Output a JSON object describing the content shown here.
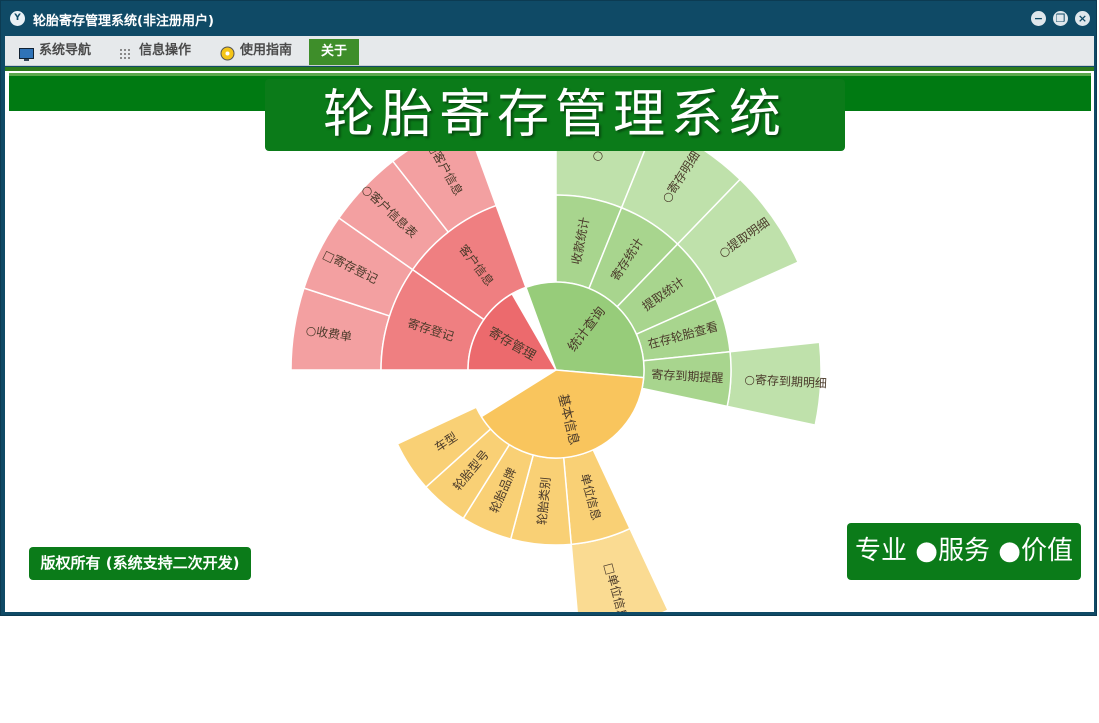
{
  "window": {
    "title": "轮胎寄存管理系统(非注册用户)",
    "app_icon": "Y",
    "buttons": {
      "minimize": "−",
      "restore": "❐",
      "close": "×"
    }
  },
  "menu": {
    "items": [
      {
        "label": "系统导航",
        "icon": "monitor-icon"
      },
      {
        "label": "信息操作",
        "icon": "grid-icon"
      },
      {
        "label": "使用指南",
        "icon": "help-icon"
      },
      {
        "label": "关于",
        "active": true
      }
    ]
  },
  "banner_title": "轮胎寄存管理系统",
  "copyright": "版权所有 (系统支持二次开发)",
  "slogan": "专业 ●服务 ●价值",
  "colors": {
    "red": "#ec6a6d",
    "green": "#97cc7a",
    "yellow": "#f9c55d",
    "brand": "#0b7b19"
  },
  "sunburst": {
    "type": "sunburst",
    "groups": [
      {
        "name": "寄存管理",
        "color": "#ec6a6d",
        "c1": "#ef7f81",
        "c2": "#f3a0a1",
        "start": -90,
        "end": -30,
        "children": [
          {
            "name": "寄存登记",
            "start": -90,
            "end": -55,
            "leaves": [
              {
                "name": "○收费单",
                "start": -90,
                "end": -72
              },
              {
                "name": "□寄存登记",
                "start": -72,
                "end": -55
              }
            ]
          },
          {
            "name": "客户信息",
            "start": -55,
            "end": -20,
            "leaves": [
              {
                "name": "○客户信息表",
                "start": -55,
                "end": -38
              },
              {
                "name": "□客户信息",
                "start": -38,
                "end": -20
              }
            ]
          }
        ]
      },
      {
        "name": "统计查询",
        "color": "#97cc7a",
        "c1": "#a8d58e",
        "c2": "#bfe1ab",
        "start": -20,
        "end": 95,
        "children": [
          {
            "name": "收款统计",
            "start": 0,
            "end": 22,
            "leaves": [
              {
                "name": "○收款",
                "start": 0,
                "end": 22
              }
            ]
          },
          {
            "name": "寄存统计",
            "start": 22,
            "end": 44,
            "leaves": [
              {
                "name": "○寄存明细",
                "start": 22,
                "end": 44
              }
            ]
          },
          {
            "name": "提取统计",
            "start": 44,
            "end": 66,
            "leaves": [
              {
                "name": "○提取明细",
                "start": 44,
                "end": 66
              }
            ]
          },
          {
            "name": "在存轮胎查看",
            "start": 66,
            "end": 84,
            "leaves": []
          },
          {
            "name": "寄存到期提醒",
            "start": 84,
            "end": 102,
            "leaves": [
              {
                "name": "○寄存到期明细",
                "start": 84,
                "end": 102
              }
            ]
          }
        ]
      },
      {
        "name": "基本信息",
        "color": "#f9c55d",
        "c1": "#f9d075",
        "c2": "#fadb92",
        "start": 95,
        "end": 238,
        "children": [
          {
            "name": "单位信息",
            "start": 155,
            "end": 175,
            "leaves": [
              {
                "name": "□单位信息",
                "start": 155,
                "end": 175
              }
            ]
          },
          {
            "name": "轮胎类别",
            "start": 175,
            "end": 195,
            "leaves": []
          },
          {
            "name": "轮胎品牌",
            "start": 195,
            "end": 212,
            "leaves": []
          },
          {
            "name": "轮胎型号",
            "start": 212,
            "end": 228,
            "leaves": []
          },
          {
            "name": "车型",
            "start": 228,
            "end": 245,
            "leaves": []
          }
        ]
      }
    ]
  }
}
